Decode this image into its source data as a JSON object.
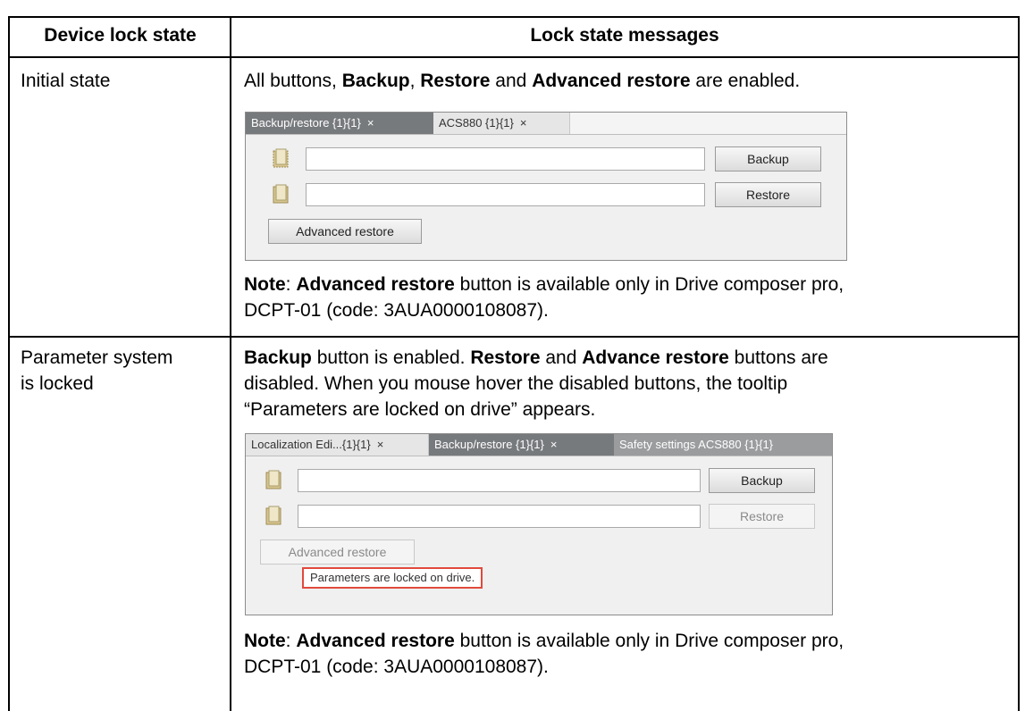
{
  "table": {
    "headers": {
      "col1": "Device lock state",
      "col2": "Lock state messages"
    },
    "row1": {
      "state": "Initial state",
      "desc": {
        "p1": "All buttons, ",
        "b1": "Backup",
        "p2": ", ",
        "b2": "Restore",
        "p3": " and ",
        "b3": "Advanced restore",
        "p4": " are enabled."
      },
      "note": {
        "label": "Note",
        "p1": ": ",
        "b1": "Advanced restore",
        "p2": " button is available only in Drive composer pro,",
        "line2": "DCPT-01 (code: 3AUA0000108087)."
      },
      "panel": {
        "tabs": [
          "Backup/restore {1}{1}",
          "ACS880 {1}{1}"
        ],
        "backup_label": "Backup",
        "restore_label": "Restore",
        "advanced_label": "Advanced restore",
        "backup_value": "",
        "restore_value": ""
      }
    },
    "row2": {
      "state_line1": "Parameter system",
      "state_line2": "is locked",
      "desc": {
        "b1": "Backup",
        "p1": " button is enabled. ",
        "b2": "Restore",
        "p2": " and ",
        "b3": "Advance restore",
        "p3": " buttons are",
        "line2": "disabled. When you mouse hover the disabled buttons, the tooltip",
        "line3": "“Parameters are locked on drive” appears."
      },
      "note": {
        "label": "Note",
        "p1": ": ",
        "b1": "Advanced restore",
        "p2": " button is available only in Drive composer pro,",
        "line2": "DCPT-01 (code: 3AUA0000108087)."
      },
      "panel": {
        "tabs": [
          "Localization Edi...{1}{1}",
          "Backup/restore {1}{1}",
          "Safety settings ACS880 {1}{1}"
        ],
        "backup_label": "Backup",
        "restore_label": "Restore",
        "advanced_label": "Advanced restore",
        "tooltip": "Parameters are locked on drive.",
        "backup_value": "",
        "restore_value": ""
      }
    },
    "close_glyph": "×",
    "colors": {
      "border": "#000000",
      "tab_active": "#777a7d",
      "tooltip_border": "#e04a3c"
    }
  }
}
